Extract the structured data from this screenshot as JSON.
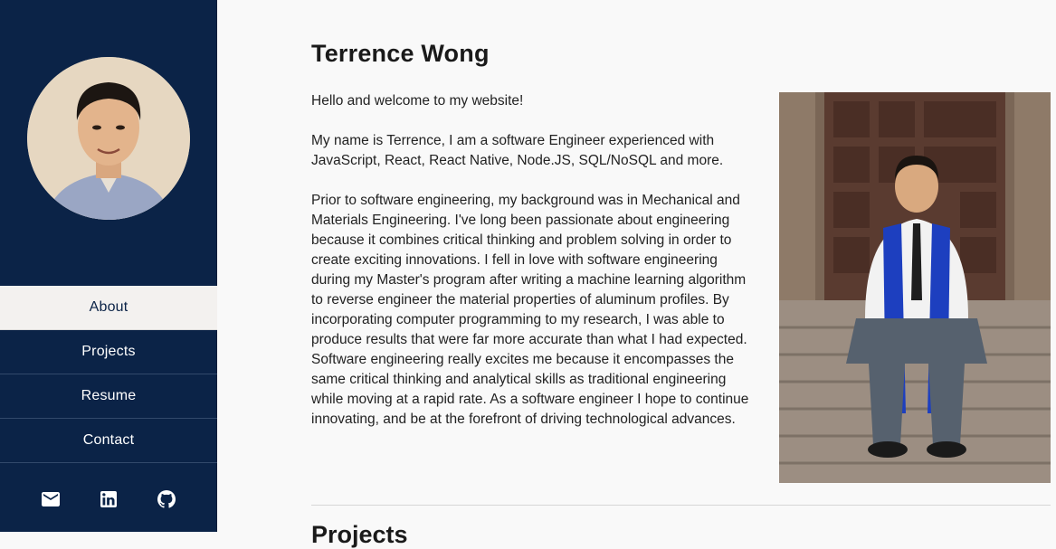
{
  "sidebar": {
    "avatar_alt": "Profile photo",
    "nav": [
      {
        "label": "About",
        "active": true
      },
      {
        "label": "Projects",
        "active": false
      },
      {
        "label": "Resume",
        "active": false
      },
      {
        "label": "Contact",
        "active": false
      }
    ],
    "social": [
      {
        "icon": "email-icon"
      },
      {
        "icon": "linkedin-icon"
      },
      {
        "icon": "github-icon"
      }
    ]
  },
  "main": {
    "title": "Terrence Wong",
    "paragraphs": [
      "Hello and welcome to my website!",
      "My name is Terrence, I am a software Engineer experienced with JavaScript, React, React Native, Node.JS, SQL/NoSQL and more.",
      "Prior to software engineering, my background was in Mechanical and Materials Engineering. I've long been passionate about engineering because it combines critical thinking and problem solving in order to create exciting innovations. I fell in love with software engineering during my Master's program after writing a machine learning algorithm to reverse engineer the material properties of aluminum profiles. By incorporating computer programming to my research, I was able to produce results that were far more accurate than what I had expected. Software engineering really excites me because it encompasses the same critical thinking and analytical skills as traditional engineering while moving at a rapid rate. As a software engineer I hope to continue innovating, and be at the forefront of driving technological advances."
    ],
    "next_section_heading": "Projects"
  },
  "colors": {
    "sidebar_bg": "#0b2347",
    "active_nav_bg": "#f3f1ef",
    "page_bg": "#f9f9f9"
  }
}
